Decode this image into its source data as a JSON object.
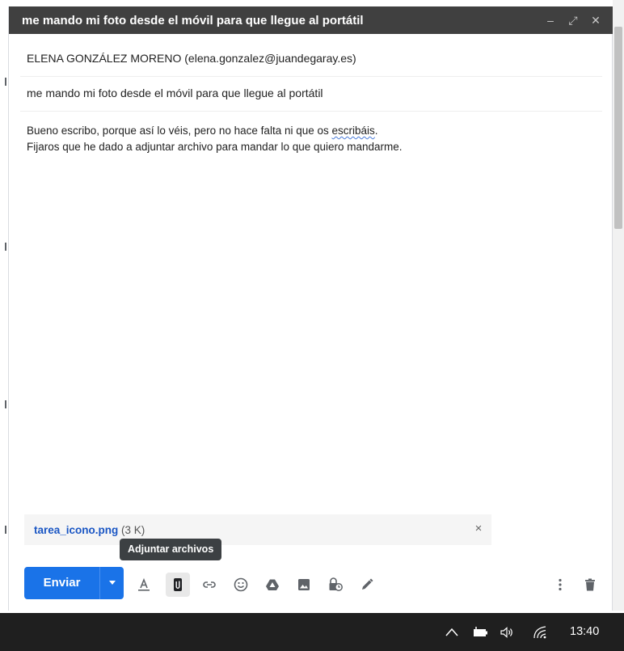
{
  "window": {
    "title": "me mando mi foto desde el móvil para que llegue al portátil",
    "minimize_glyph": "–",
    "expand_glyph": "⤢",
    "close_glyph": "✕"
  },
  "compose": {
    "recipients": "ELENA GONZÁLEZ MORENO (elena.gonzalez@juandegaray.es)",
    "subject": "me mando mi foto desde el móvil para que llegue al portátil",
    "body_line1_before": "Bueno escribo, porque así lo véis, pero no hace falta ni que os ",
    "body_line1_spell": "escribáis",
    "body_line1_after": ".",
    "body_line2": "Fijaros que he dado a adjuntar archivo para mandar lo que quiero mandarme."
  },
  "attachment": {
    "name": "tarea_icono.png",
    "size": " (3 K)",
    "remove_glyph": "×"
  },
  "tooltip": "Adjuntar archivos",
  "toolbar": {
    "send_label": "Enviar",
    "icons": [
      "text-format-icon",
      "attach-icon",
      "link-icon",
      "emoji-icon",
      "drive-icon",
      "photo-icon",
      "confidential-icon",
      "signature-icon",
      "more-options-icon",
      "trash-icon"
    ]
  },
  "taskbar": {
    "time": "13:40"
  },
  "colors": {
    "titlebar": "#404040",
    "send": "#1a73e8",
    "attachment_link": "#1a56c4",
    "taskbar": "#1f1f1f"
  }
}
